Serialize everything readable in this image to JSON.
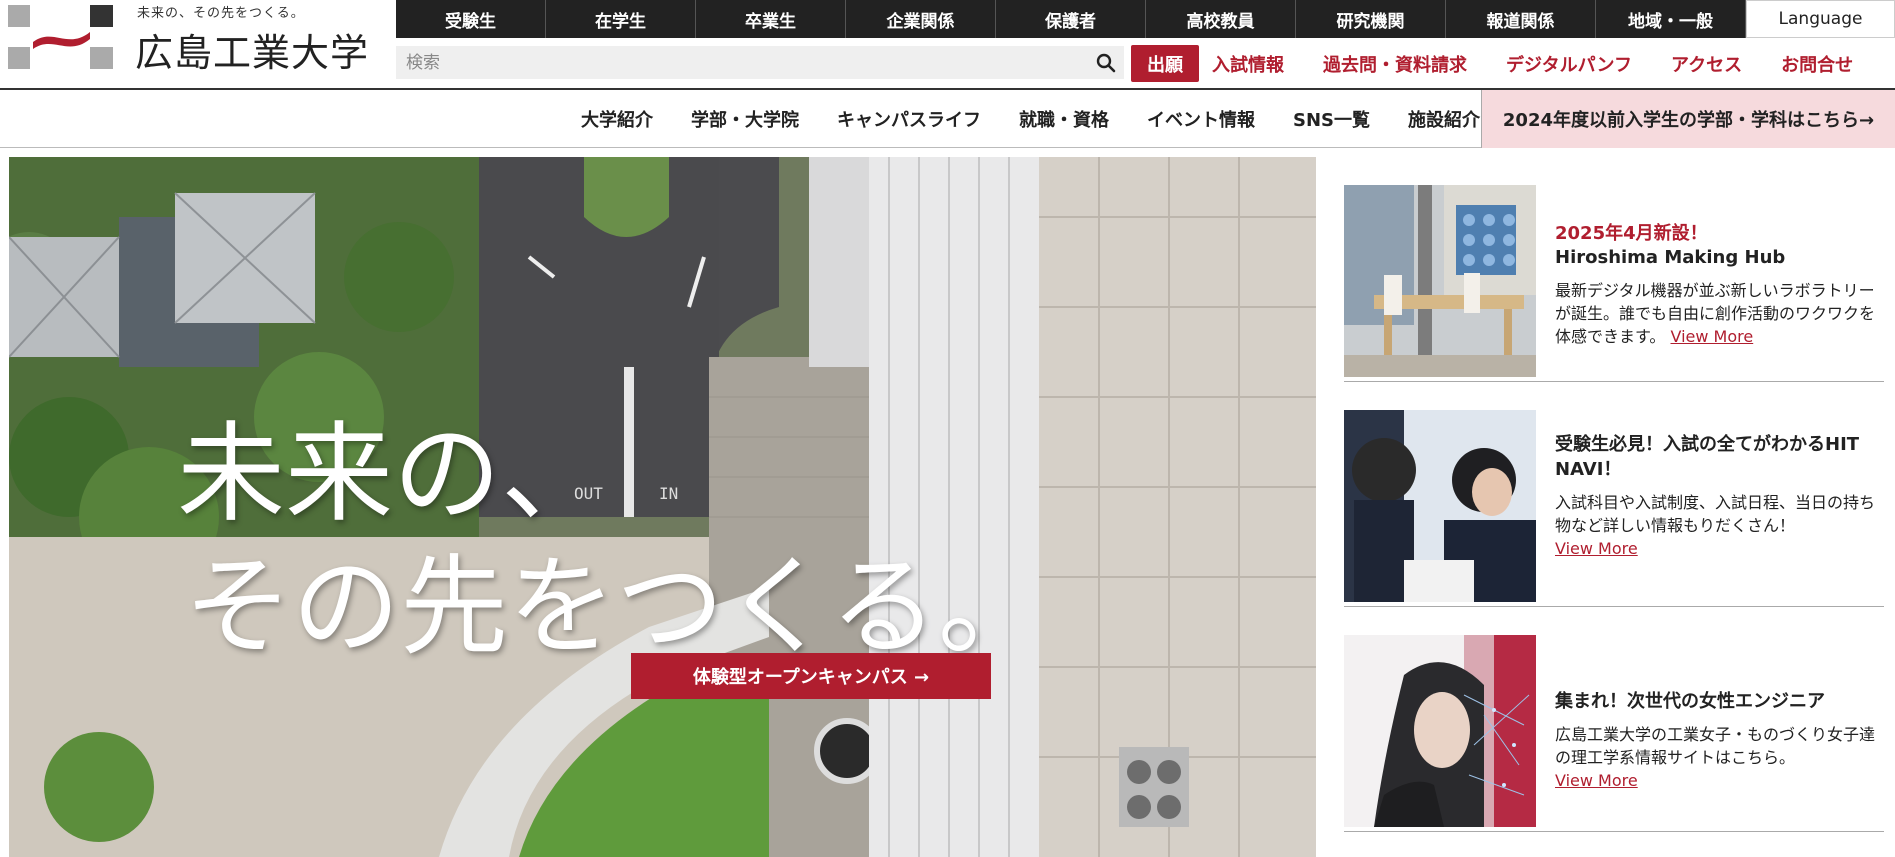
{
  "logo": {
    "tagline": "未来の、その先をつくる。",
    "name": "広島工業大学"
  },
  "audience_nav": {
    "items": [
      "受験生",
      "在学生",
      "卒業生",
      "企業関係",
      "保護者",
      "高校教員",
      "研究機関",
      "報道関係",
      "地域・一般"
    ],
    "language": "Language"
  },
  "search": {
    "placeholder": "検索",
    "value": ""
  },
  "apply_button": "出願",
  "util_links": [
    "入試情報",
    "過去問・資料請求",
    "デジタルパンフ",
    "アクセス",
    "お問合せ"
  ],
  "main_nav": {
    "items": [
      "大学紹介",
      "学部・大学院",
      "キャンパスライフ",
      "就職・資格",
      "イベント情報",
      "SNS一覧",
      "施設紹介"
    ],
    "old_students": "2024年度以前入学生の学部・学科はこちら→"
  },
  "hero": {
    "line1": "未来の、",
    "line2": "その先をつくる。",
    "cta": "体験型オープンキャンパス →",
    "ground_text_out": "OUT",
    "ground_text_in": "IN"
  },
  "news": [
    {
      "tag": "2025年4月新設！",
      "title": "Hiroshima Making Hub",
      "text": "最新デジタル機器が並ぶ新しいラボラトリーが誕生。誰でも自由に創作活動のワクワクを体感できます。",
      "link": "View More"
    },
    {
      "tag": "",
      "title": "受験生必見！入試の全てがわかるHIT NAVI！",
      "text": "入試科目や入試制度、入試日程、当日の持ち物など詳しい情報もりだくさん！",
      "link": "View More"
    },
    {
      "tag": "",
      "title": "集まれ！次世代の女性エンジニア",
      "text": "広島工業大学の工業女子・ものづくり女子達の理工学系情報サイトはこちら。",
      "link": "View More"
    }
  ],
  "colors": {
    "brand_red": "#b01e2f",
    "nav_dark": "#222222",
    "highlight_pink": "#f6dadd"
  },
  "icons": {
    "logo": "university-logo-mark",
    "search": "search-icon"
  }
}
